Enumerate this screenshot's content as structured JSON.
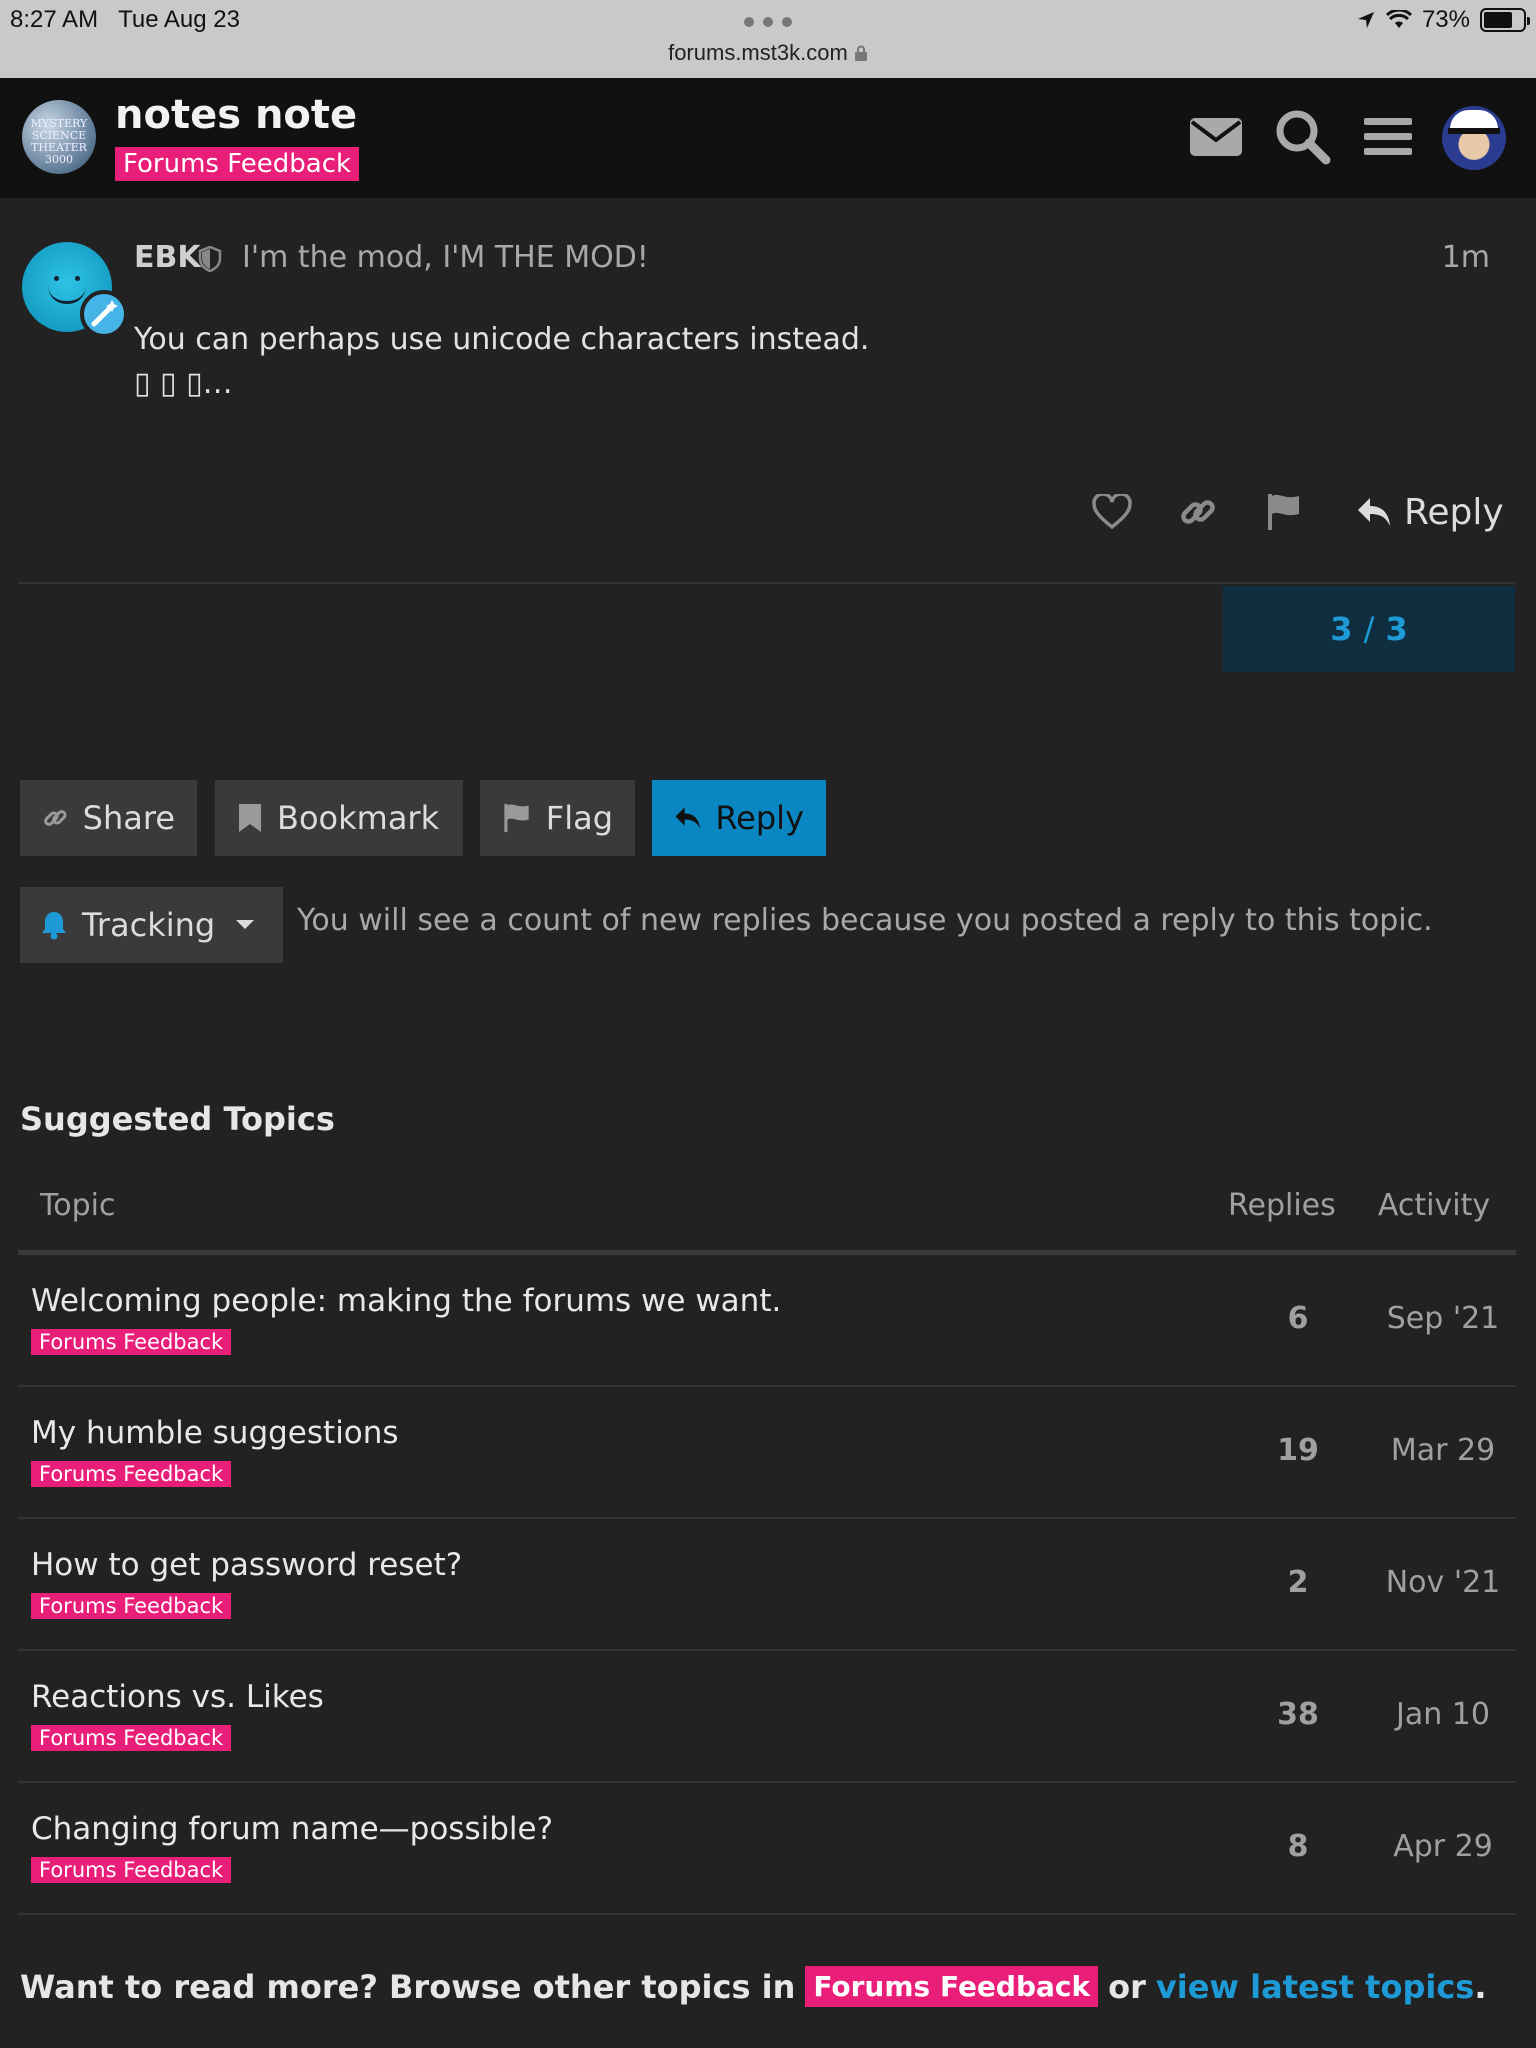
{
  "status_bar": {
    "time": "8:27 AM",
    "date": "Tue Aug 23",
    "url": "forums.mst3k.com",
    "battery": "73%",
    "battery_level": 0.73
  },
  "header": {
    "logo_text": "MYSTERY SCIENCE THEATER 3000",
    "topic_title": "notes note",
    "category": "Forums Feedback",
    "icons": [
      "envelope-icon",
      "search-icon",
      "hamburger-menu-icon",
      "user-avatar"
    ]
  },
  "post": {
    "username": "EBK",
    "user_title": "I'm the mod, I'M THE MOD!",
    "time": "1m",
    "body_line1": "You can perhaps use unicode characters instead.",
    "body_line2": "▯ ▯ ▯…",
    "reply_label": "Reply"
  },
  "progress": {
    "current": "3",
    "total": "3",
    "separator": "/"
  },
  "footer_buttons": {
    "share": "Share",
    "bookmark": "Bookmark",
    "flag": "Flag",
    "reply": "Reply"
  },
  "tracking": {
    "label": "Tracking",
    "description": "You will see a count of new replies because you posted a reply to this topic."
  },
  "suggested": {
    "title": "Suggested Topics",
    "headers": {
      "topic": "Topic",
      "replies": "Replies",
      "activity": "Activity"
    },
    "rows": [
      {
        "title": "Welcoming people: making the forums we want.",
        "category": "Forums Feedback",
        "replies": "6",
        "activity": "Sep '21"
      },
      {
        "title": "My humble suggestions",
        "category": "Forums Feedback",
        "replies": "19",
        "activity": "Mar 29"
      },
      {
        "title": "How to get password reset?",
        "category": "Forums Feedback",
        "replies": "2",
        "activity": "Nov '21"
      },
      {
        "title": "Reactions vs. Likes",
        "category": "Forums Feedback",
        "replies": "38",
        "activity": "Jan 10"
      },
      {
        "title": "Changing forum name—possible?",
        "category": "Forums Feedback",
        "replies": "8",
        "activity": "Apr 29"
      }
    ]
  },
  "read_more": {
    "prefix": "Want to read more? Browse other topics in",
    "category": "Forums Feedback",
    "or": "or",
    "link": "view latest topics",
    "suffix": "."
  },
  "colors": {
    "accent": "#0a86c2",
    "category": "#e91e79",
    "background": "#222222",
    "header": "#111111"
  }
}
